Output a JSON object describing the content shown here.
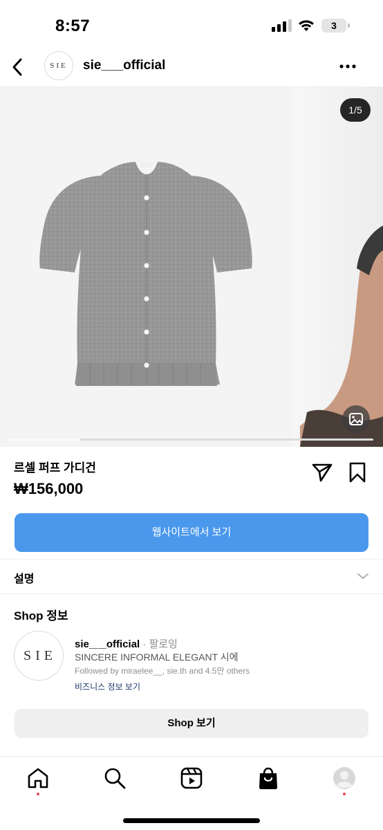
{
  "status_bar": {
    "time": "8:57",
    "battery": "3",
    "icons": [
      "cellular-signal-icon",
      "wifi-icon",
      "battery-icon"
    ]
  },
  "header": {
    "avatar_text": "SIE",
    "username": "sie___official",
    "icons": [
      "back-arrow-icon",
      "more-dots-icon"
    ]
  },
  "carousel": {
    "counter": "1/5",
    "current_slide": 1,
    "total_slides": 5,
    "image_icon": "image-icon"
  },
  "product": {
    "name": "르셀 퍼프 가디건",
    "price": "₩156,000",
    "icons": [
      "send-share-icon",
      "bookmark-icon"
    ]
  },
  "website_button": {
    "label": "웹사이트에서 보기",
    "color": "#4a98ec"
  },
  "description": {
    "label": "설명",
    "icon": "chevron-down-icon"
  },
  "shop_info": {
    "title": "Shop 정보",
    "avatar_text": "SIE",
    "name": "sie___official",
    "separator": "·",
    "follow_label": "팔로잉",
    "bio": "SINCERE INFORMAL ELEGANT 시에",
    "followed_by": "Followed by miraelee__, sie.th and 4.5만 others",
    "business_link": "비즈니스 정보 보기",
    "shop_button": "Shop 보기"
  },
  "tabbar": {
    "tabs": [
      {
        "name": "home",
        "icon": "home-icon",
        "notification": true
      },
      {
        "name": "search",
        "icon": "search-icon",
        "notification": false
      },
      {
        "name": "reels",
        "icon": "reels-icon",
        "notification": false
      },
      {
        "name": "shop",
        "icon": "shopping-bag-icon",
        "notification": false,
        "active": true
      },
      {
        "name": "profile",
        "icon": "profile-avatar-icon",
        "notification": true
      }
    ],
    "notification_color": "#ed4956"
  }
}
